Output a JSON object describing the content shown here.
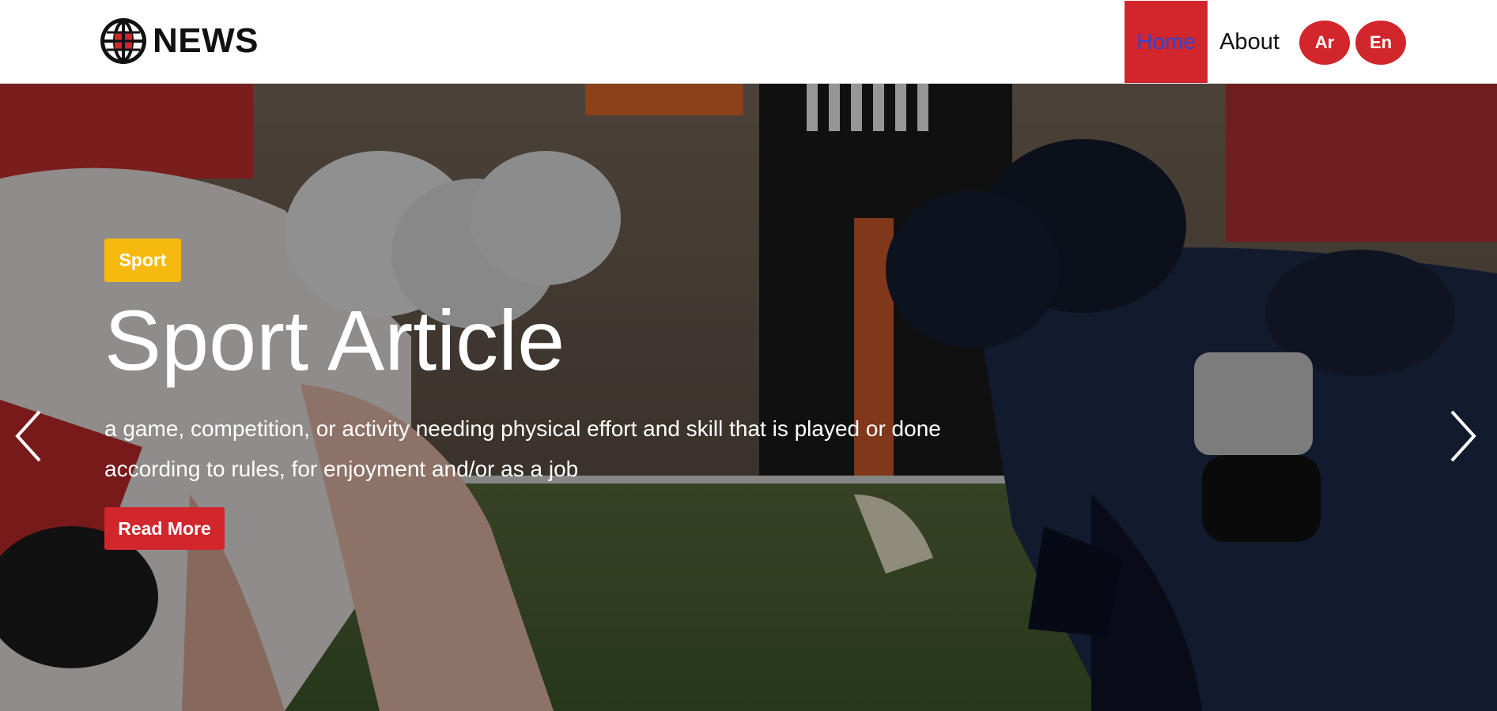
{
  "header": {
    "brand": "NEWS",
    "nav": {
      "home": "Home",
      "about": "About"
    },
    "lang": {
      "ar": "Ar",
      "en": "En"
    },
    "icons": {
      "logo": "globe-icon"
    }
  },
  "hero": {
    "category": "Sport",
    "title": "Sport Article",
    "description": "a game, competition, or activity needing physical effort and skill that is played or done according to rules, for enjoyment and/or as a job",
    "cta": "Read More",
    "icons": {
      "prev": "chevron-left-icon",
      "next": "chevron-right-icon"
    }
  },
  "colors": {
    "accent_red": "#d1262b",
    "badge_yellow": "#f6b90e",
    "home_link_blue": "#2b46d6"
  }
}
